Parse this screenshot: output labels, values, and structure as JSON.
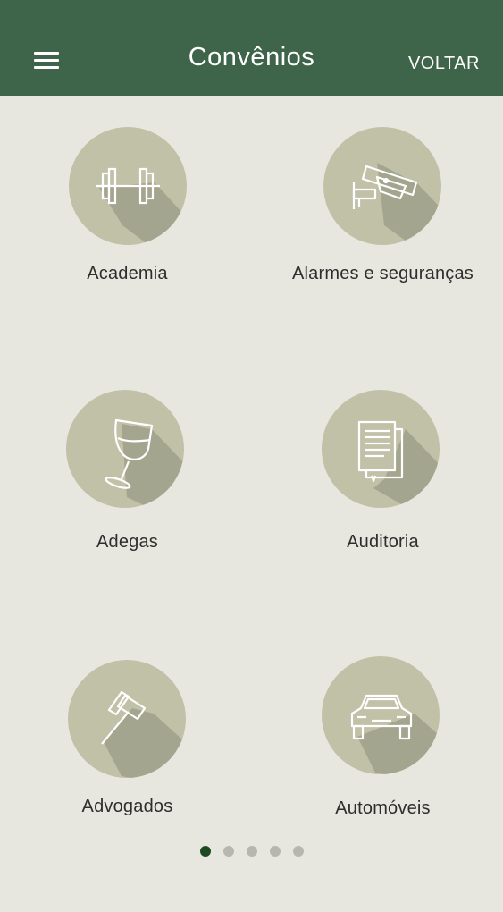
{
  "header": {
    "title": "Convênios",
    "back_label": "VOLTAR"
  },
  "categories": [
    {
      "label": "Academia",
      "icon": "dumbbell-icon"
    },
    {
      "label": "Alarmes e seguranças",
      "icon": "security-camera-icon"
    },
    {
      "label": "Adegas",
      "icon": "wine-glass-icon"
    },
    {
      "label": "Auditoria",
      "icon": "documents-icon"
    },
    {
      "label": "Advogados",
      "icon": "gavel-icon"
    },
    {
      "label": "Automóveis",
      "icon": "car-icon"
    }
  ],
  "pagination": {
    "current_page": 1,
    "total_pages": 5
  },
  "colors": {
    "header_bg": "#3e644a",
    "background": "#e8e7df",
    "circle": "#c0c1a7",
    "circle_shadow": "#a3a48e",
    "active_dot": "#1f4a21",
    "inactive_dot": "#b7b7b1"
  }
}
